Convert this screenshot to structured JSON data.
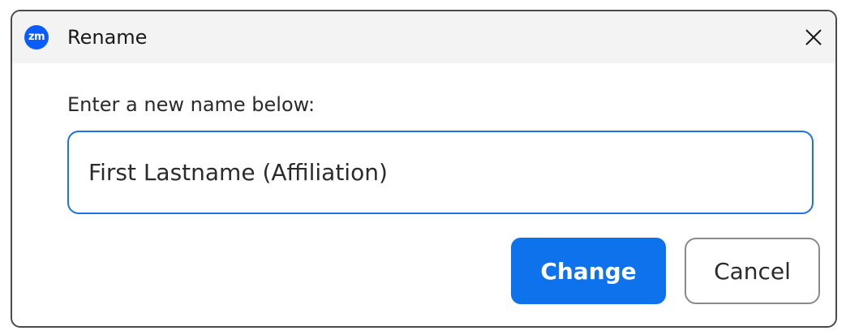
{
  "window": {
    "title": "Rename",
    "app_icon": "zoom-logo",
    "app_icon_text": "zm",
    "close_icon": "close-icon"
  },
  "dialog": {
    "prompt": "Enter a new name below:",
    "name_value": "First Lastname (Affiliation)",
    "change_label": "Change",
    "cancel_label": "Cancel"
  },
  "colors": {
    "accent": "#0e72ed",
    "logo": "#0b5cff",
    "input_border": "#1a73e8",
    "titlebar_bg": "#f3f3f3"
  }
}
